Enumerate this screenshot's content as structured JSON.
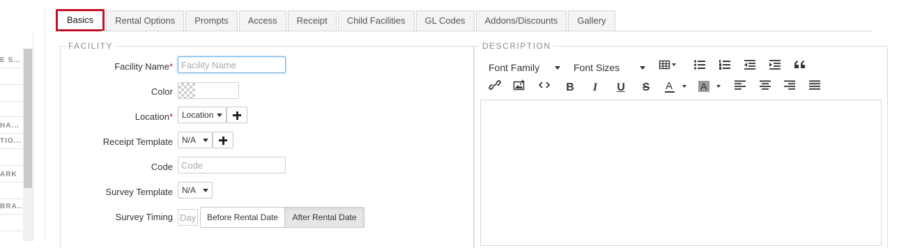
{
  "sidebar": {
    "rows": [
      "E S...",
      "",
      "",
      "",
      "HA...",
      "TIO...",
      "",
      "ARK",
      "",
      "BRA...",
      ""
    ]
  },
  "tabs": [
    {
      "label": "Basics",
      "active": true
    },
    {
      "label": "Rental Options"
    },
    {
      "label": "Prompts"
    },
    {
      "label": "Access"
    },
    {
      "label": "Receipt"
    },
    {
      "label": "Child Facilities"
    },
    {
      "label": "GL Codes"
    },
    {
      "label": "Addons/Discounts"
    },
    {
      "label": "Gallery"
    }
  ],
  "facility": {
    "legend": "FACILITY",
    "facility_name": {
      "label": "Facility Name",
      "required": "*",
      "placeholder": "Facility Name"
    },
    "color": {
      "label": "Color"
    },
    "location": {
      "label": "Location",
      "required": "*",
      "value": "Location"
    },
    "receipt_template": {
      "label": "Receipt Template",
      "value": "N/A"
    },
    "code": {
      "label": "Code",
      "placeholder": "Code"
    },
    "survey_template": {
      "label": "Survey Template",
      "value": "N/A"
    },
    "survey_timing": {
      "label": "Survey Timing",
      "day_placeholder": "Day",
      "before": "Before Rental Date",
      "after": "After Rental Date"
    }
  },
  "description": {
    "legend": "DESCRIPTION",
    "font_family": "Font Family",
    "font_sizes": "Font Sizes",
    "toolbar_icons": [
      "table-icon",
      "bullet-list-icon",
      "numbered-list-icon",
      "outdent-icon",
      "indent-icon",
      "blockquote-icon",
      "link-icon",
      "image-icon",
      "code-view-icon",
      "bold-icon",
      "italic-icon",
      "underline-icon",
      "strikethrough-icon",
      "font-color-icon",
      "background-color-icon",
      "align-left-icon",
      "align-center-icon",
      "align-right-icon",
      "justify-icon"
    ]
  },
  "colors": {
    "accent": "#c0112b",
    "focus": "#66afe9",
    "border": "#d6d6d6"
  }
}
